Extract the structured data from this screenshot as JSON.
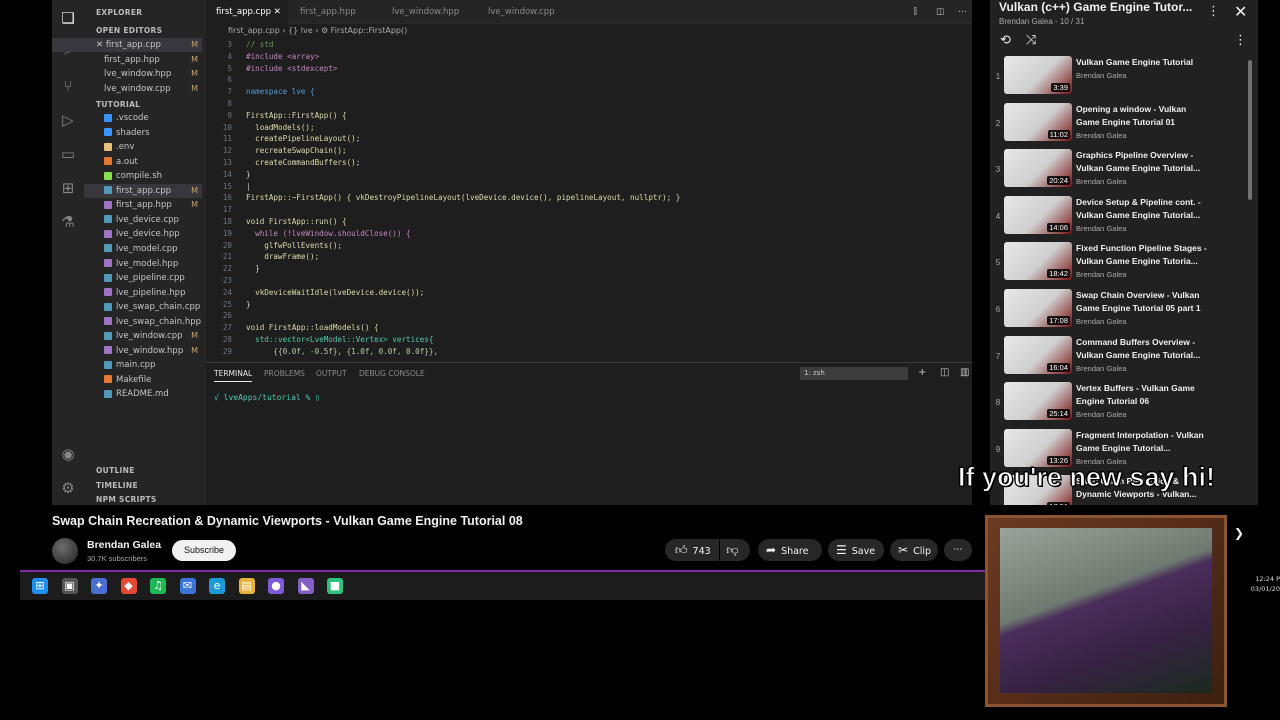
{
  "editor": {
    "activity_icons": [
      "files-icon",
      "search-icon",
      "source-control-icon",
      "run-debug-icon",
      "remote-explorer-icon",
      "extensions-icon",
      "testing-icon",
      "account-icon",
      "settings-icon"
    ],
    "explorer_title": "EXPLORER",
    "open_editors_label": "OPEN EDITORS",
    "open_editors": [
      {
        "name": "first_app.cpp",
        "mark": "M",
        "active": true
      },
      {
        "name": "first_app.hpp",
        "mark": "M"
      },
      {
        "name": "lve_window.hpp",
        "mark": "M"
      },
      {
        "name": "lve_window.cpp",
        "mark": "M"
      }
    ],
    "folder_label": "TUTORIAL",
    "files": [
      {
        "name": ".vscode",
        "color": "#3794ff"
      },
      {
        "name": "shaders",
        "color": "#3794ff"
      },
      {
        "name": ".env",
        "color": "#e8c07d"
      },
      {
        "name": "a.out",
        "color": "#e37933"
      },
      {
        "name": "compile.sh",
        "color": "#89e051"
      },
      {
        "name": "first_app.cpp",
        "mark": "M",
        "color": "#519aba",
        "active": true
      },
      {
        "name": "first_app.hpp",
        "mark": "M",
        "color": "#a074c4"
      },
      {
        "name": "lve_device.cpp",
        "color": "#519aba"
      },
      {
        "name": "lve_device.hpp",
        "color": "#a074c4"
      },
      {
        "name": "lve_model.cpp",
        "color": "#519aba"
      },
      {
        "name": "lve_model.hpp",
        "color": "#a074c4"
      },
      {
        "name": "lve_pipeline.cpp",
        "color": "#519aba"
      },
      {
        "name": "lve_pipeline.hpp",
        "color": "#a074c4"
      },
      {
        "name": "lve_swap_chain.cpp",
        "color": "#519aba"
      },
      {
        "name": "lve_swap_chain.hpp",
        "color": "#a074c4"
      },
      {
        "name": "lve_window.cpp",
        "mark": "M",
        "color": "#519aba"
      },
      {
        "name": "lve_window.hpp",
        "mark": "M",
        "color": "#a074c4"
      },
      {
        "name": "main.cpp",
        "color": "#519aba"
      },
      {
        "name": "Makefile",
        "color": "#e37933"
      },
      {
        "name": "README.md",
        "color": "#519aba"
      }
    ],
    "outline_label": "OUTLINE",
    "timeline_label": "TIMELINE",
    "npm_label": "NPM SCRIPTS",
    "tabs": [
      {
        "name": "first_app.cpp",
        "active": true
      },
      {
        "name": "first_app.hpp"
      },
      {
        "name": "lve_window.hpp"
      },
      {
        "name": "lve_window.cpp"
      }
    ],
    "breadcrumb": "first_app.cpp  ›  {} lve  ›  ⚙ FirstApp::FirstApp()",
    "code_lines": [
      {
        "n": "3",
        "t": "// std",
        "c": "#6a9955"
      },
      {
        "n": "4",
        "t": "#include <array>",
        "c": "#c586c0"
      },
      {
        "n": "5",
        "t": "#include <stdexcept>",
        "c": "#c586c0"
      },
      {
        "n": "6",
        "t": "",
        "c": "#d4d4d4"
      },
      {
        "n": "7",
        "t": "namespace lve {",
        "c": "#569cd6"
      },
      {
        "n": "8",
        "t": "",
        "c": "#d4d4d4"
      },
      {
        "n": "9",
        "t": "FirstApp::FirstApp() {",
        "c": "#dcdcaa"
      },
      {
        "n": "10",
        "t": "  loadModels();",
        "c": "#dcdcaa"
      },
      {
        "n": "11",
        "t": "  createPipelineLayout();",
        "c": "#dcdcaa"
      },
      {
        "n": "12",
        "t": "  recreateSwapChain();",
        "c": "#dcdcaa"
      },
      {
        "n": "13",
        "t": "  createCommandBuffers();",
        "c": "#dcdcaa"
      },
      {
        "n": "14",
        "t": "}",
        "c": "#d4d4d4"
      },
      {
        "n": "15",
        "t": "|",
        "c": "#d4d4d4"
      },
      {
        "n": "16",
        "t": "FirstApp::~FirstApp() { vkDestroyPipelineLayout(lveDevice.device(), pipelineLayout, nullptr); }",
        "c": "#dcdcaa"
      },
      {
        "n": "17",
        "t": "",
        "c": "#d4d4d4"
      },
      {
        "n": "18",
        "t": "void FirstApp::run() {",
        "c": "#dcdcaa"
      },
      {
        "n": "19",
        "t": "  while (!lveWindow.shouldClose()) {",
        "c": "#c586c0"
      },
      {
        "n": "20",
        "t": "    glfwPollEvents();",
        "c": "#dcdcaa"
      },
      {
        "n": "21",
        "t": "    drawFrame();",
        "c": "#dcdcaa"
      },
      {
        "n": "22",
        "t": "  }",
        "c": "#d4d4d4"
      },
      {
        "n": "23",
        "t": "",
        "c": "#d4d4d4"
      },
      {
        "n": "24",
        "t": "  vkDeviceWaitIdle(lveDevice.device());",
        "c": "#dcdcaa"
      },
      {
        "n": "25",
        "t": "}",
        "c": "#d4d4d4"
      },
      {
        "n": "26",
        "t": "",
        "c": "#d4d4d4"
      },
      {
        "n": "27",
        "t": "void FirstApp::loadModels() {",
        "c": "#dcdcaa"
      },
      {
        "n": "28",
        "t": "  std::vector<LveModel::Vertex> vertices{",
        "c": "#4ec9b0"
      },
      {
        "n": "29",
        "t": "      {{0.0f, -0.5f}, {1.0f, 0.0f, 0.0f}},",
        "c": "#b5cea8"
      }
    ],
    "panel_tabs": [
      "TERMINAL",
      "PROBLEMS",
      "OUTPUT",
      "DEBUG CONSOLE"
    ],
    "terminal_select": "1: zsh",
    "terminal_prompt": "√ lveApps/tutorial % ▯"
  },
  "video": {
    "title": "Swap Chain Recreation & Dynamic Viewports - Vulkan Game Engine Tutorial 08",
    "channel": "Brendan Galea",
    "subscribers": "30.7K subscribers",
    "subscribe_label": "Subscribe",
    "likes": "743",
    "share_label": "Share",
    "save_label": "Save",
    "clip_label": "Clip"
  },
  "playlist": {
    "title": "Vulkan (c++) Game Engine Tutor...",
    "subtitle": "Brendan Galea - 10 / 31",
    "items": [
      {
        "num": "1",
        "title": "Vulkan Game Engine Tutorial",
        "channel": "Brendan Galea",
        "duration": "3:39"
      },
      {
        "num": "2",
        "title": "Opening a window - Vulkan Game Engine Tutorial 01",
        "channel": "Brendan Galea",
        "duration": "11:02"
      },
      {
        "num": "3",
        "title": "Graphics Pipeline Overview - Vulkan Game Engine Tutorial...",
        "channel": "Brendan Galea",
        "duration": "20:24"
      },
      {
        "num": "4",
        "title": "Device Setup & Pipeline cont. - Vulkan Game Engine Tutorial...",
        "channel": "Brendan Galea",
        "duration": "14:06"
      },
      {
        "num": "5",
        "title": "Fixed Function Pipeline Stages - Vulkan Game Engine Tutoria...",
        "channel": "Brendan Galea",
        "duration": "18:42"
      },
      {
        "num": "6",
        "title": "Swap Chain Overview - Vulkan Game Engine Tutorial 05 part 1",
        "channel": "Brendan Galea",
        "duration": "17:08"
      },
      {
        "num": "7",
        "title": "Command Buffers Overview - Vulkan Game Engine Tutorial...",
        "channel": "Brendan Galea",
        "duration": "16:04"
      },
      {
        "num": "8",
        "title": "Vertex Buffers - Vulkan Game Engine Tutorial 06",
        "channel": "Brendan Galea",
        "duration": "25:14"
      },
      {
        "num": "9",
        "title": "Fragment Interpolation - Vulkan Game Engine Tutorial...",
        "channel": "Brendan Galea",
        "duration": "13:26"
      },
      {
        "num": "",
        "title": "Swap Chain Recreation & Dynamic Viewports - Vulkan...",
        "channel": "",
        "duration": "17:51"
      }
    ]
  },
  "overlay": {
    "text": "If you're new say hi!"
  },
  "taskbar": {
    "icons": [
      {
        "name": "windows-start-icon",
        "color": "#1f8ef1",
        "glyph": "⊞"
      },
      {
        "name": "task-view-icon",
        "color": "#555555",
        "glyph": "▣"
      },
      {
        "name": "app-icon",
        "color": "#4a6fd1",
        "glyph": "✦"
      },
      {
        "name": "app-icon",
        "color": "#e24a33",
        "glyph": "◆"
      },
      {
        "name": "spotify-icon",
        "color": "#1db954",
        "glyph": "♫"
      },
      {
        "name": "app-icon",
        "color": "#3b73d6",
        "glyph": "✉"
      },
      {
        "name": "edge-icon",
        "color": "#1c9ad6",
        "glyph": "e"
      },
      {
        "name": "file-explorer-icon",
        "color": "#e8b23a",
        "glyph": "▤"
      },
      {
        "name": "app-icon",
        "color": "#7b5cd6",
        "glyph": "●"
      },
      {
        "name": "visual-studio-icon",
        "color": "#865fc5",
        "glyph": "◣"
      },
      {
        "name": "app-icon",
        "color": "#2ec27e",
        "glyph": "■"
      }
    ],
    "time": "12:24 P",
    "date": "03/01/20"
  }
}
